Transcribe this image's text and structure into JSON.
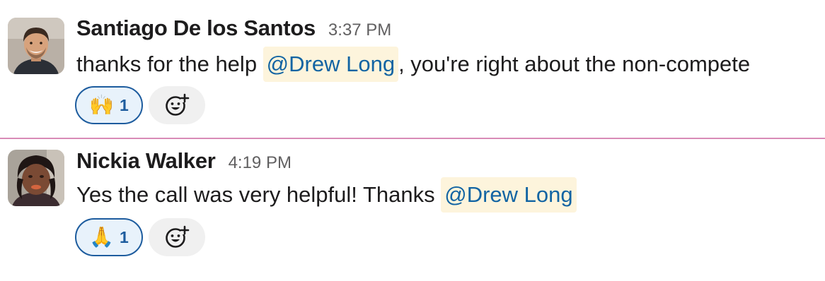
{
  "messages": [
    {
      "sender": "Santiago De los Santos",
      "timestamp": "3:37 PM",
      "text_before": "thanks for the help ",
      "mention": "@Drew Long",
      "text_after": ", you're right about the non-compete",
      "reaction": {
        "emoji": "🙌",
        "icon": "raising-hands-emoji",
        "count": "1"
      },
      "add_reaction_icon": "add-reaction-icon"
    },
    {
      "sender": "Nickia Walker",
      "timestamp": "4:19 PM",
      "text_before": "Yes the call was very helpful! Thanks ",
      "mention": "@Drew Long",
      "text_after": "",
      "reaction": {
        "emoji": "🙏",
        "icon": "folded-hands-emoji",
        "count": "1"
      },
      "add_reaction_icon": "add-reaction-icon"
    }
  ],
  "colors": {
    "mention_bg": "#fdf4dc",
    "mention_text": "#1264a3",
    "reaction_border": "#1d5c9e",
    "reaction_bg": "#e8f2fb",
    "new_divider": "#d98bb7"
  }
}
